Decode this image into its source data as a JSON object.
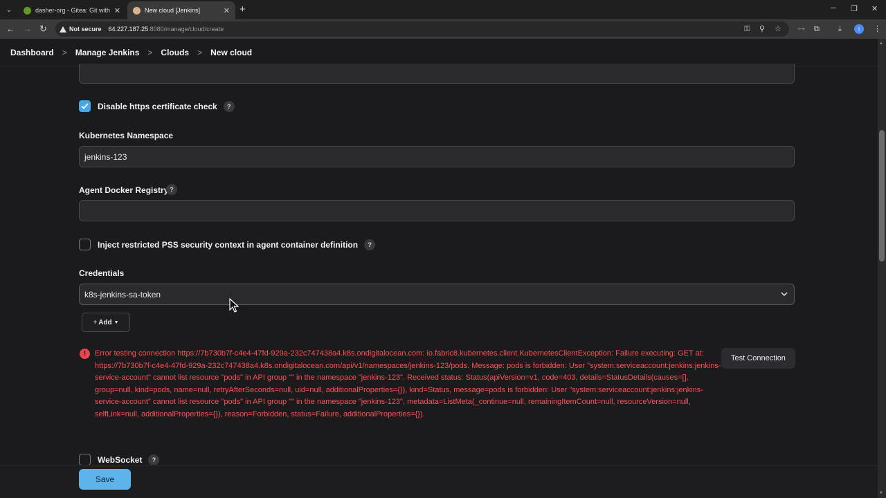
{
  "browser": {
    "tabs": [
      {
        "title": "dasher-org - Gitea: Git with a cup of tea",
        "active": false
      },
      {
        "title": "New cloud [Jenkins]",
        "active": true
      }
    ],
    "address": {
      "security_label": "Not secure",
      "host": "64.227.187.25",
      "path": ":8080/manage/cloud/create"
    }
  },
  "breadcrumb": [
    "Dashboard",
    "Manage Jenkins",
    "Clouds",
    "New cloud"
  ],
  "form": {
    "disable_https_label": "Disable https certificate check",
    "disable_https_checked": true,
    "namespace_label": "Kubernetes Namespace",
    "namespace_value": "jenkins-123",
    "registry_label": "Agent Docker Registry",
    "registry_value": "",
    "inject_pss_label": "Inject restricted PSS security context in agent container definition",
    "inject_pss_checked": false,
    "credentials_label": "Credentials",
    "credentials_value": "k8s-jenkins-sa-token",
    "add_label": "Add",
    "error_message": "Error testing connection https://7b730b7f-c4e4-47fd-929a-232c747438a4.k8s.ondigitalocean.com: io.fabric8.kubernetes.client.KubernetesClientException: Failure executing: GET at: https://7b730b7f-c4e4-47fd-929a-232c747438a4.k8s.ondigitalocean.com/api/v1/namespaces/jenkins-123/pods. Message: pods is forbidden: User \"system:serviceaccount:jenkins:jenkins-service-account\" cannot list resource \"pods\" in API group \"\" in the namespace \"jenkins-123\". Received status: Status(apiVersion=v1, code=403, details=StatusDetails(causes=[], group=null, kind=pods, name=null, retryAfterSeconds=null, uid=null, additionalProperties={}), kind=Status, message=pods is forbidden: User \"system:serviceaccount:jenkins:jenkins-service-account\" cannot list resource \"pods\" in API group \"\" in the namespace \"jenkins-123\", metadata=ListMeta(_continue=null, remainingItemCount=null, resourceVersion=null, selfLink=null, additionalProperties={}), reason=Forbidden, status=Failure, additionalProperties={}).",
    "test_connection_label": "Test Connection",
    "websocket_label": "WebSocket",
    "save_label": "Save",
    "help_glyph": "?"
  },
  "colors": {
    "accent": "#48a7e8",
    "error": "#ff4f56",
    "save": "#5eb3ea"
  }
}
